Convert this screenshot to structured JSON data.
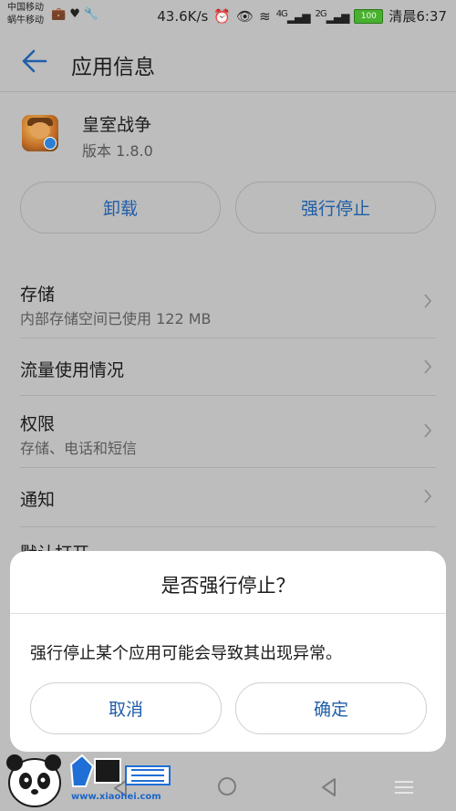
{
  "status_bar": {
    "carrier_1": "中国移动",
    "carrier_2": "蜗牛移动",
    "speed": "43.6K/s",
    "net_1": "4G",
    "net_2": "2G",
    "battery": "100",
    "time": "清晨6:37"
  },
  "app_bar": {
    "title": "应用信息"
  },
  "app": {
    "name": "皇室战争",
    "version": "版本 1.8.0"
  },
  "actions": {
    "uninstall": "卸载",
    "force_stop": "强行停止"
  },
  "list": {
    "items": [
      {
        "label": "存储",
        "sub": "内部存储空间已使用 122 MB"
      },
      {
        "label": "流量使用情况",
        "sub": ""
      },
      {
        "label": "权限",
        "sub": "存储、电话和短信"
      },
      {
        "label": "通知",
        "sub": ""
      },
      {
        "label": "默认打开",
        "sub": ""
      }
    ]
  },
  "dialog": {
    "title": "是否强行停止？",
    "message": "强行停止某个应用可能会导致其出现异常。",
    "cancel": "取消",
    "confirm": "确定"
  },
  "watermark": {
    "url": "www.xiaohei.com"
  },
  "colors": {
    "accent": "#1f5ea8",
    "dim_background": "#bdbdbd",
    "dialog_bg": "#ffffff"
  }
}
